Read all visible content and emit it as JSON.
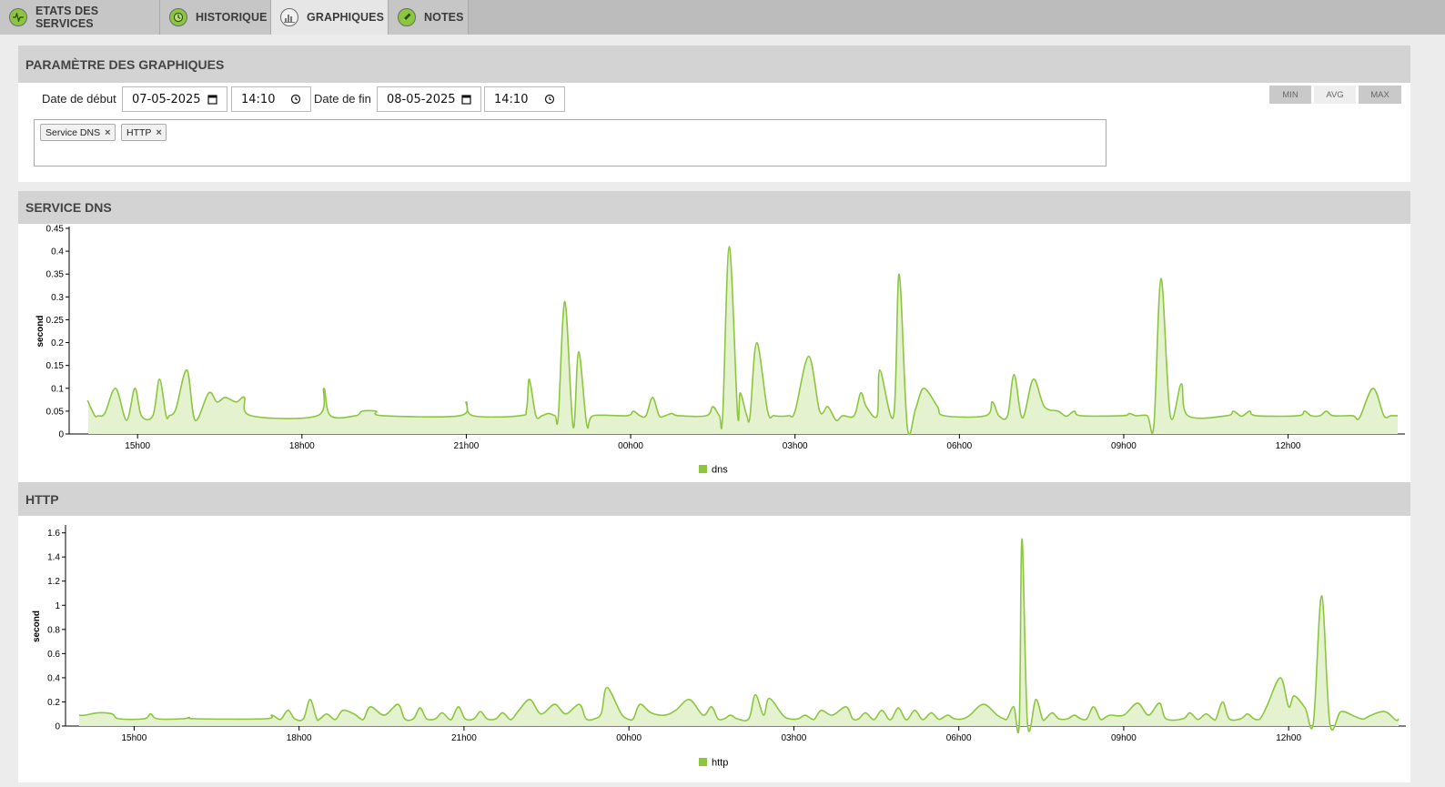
{
  "tabs": [
    {
      "label": "ETATS DES SERVICES",
      "icon": "pulse-icon",
      "active": false
    },
    {
      "label": "HISTORIQUE",
      "icon": "clock-icon",
      "active": false
    },
    {
      "label": "GRAPHIQUES",
      "icon": "bar-chart-icon",
      "active": true
    },
    {
      "label": "NOTES",
      "icon": "pencil-icon",
      "active": false
    }
  ],
  "params": {
    "title": "PARAMÈTRE DES GRAPHIQUES",
    "start_label": "Date de début",
    "start_date": "07-05-2025",
    "start_time": "14:10",
    "end_label": "Date de fin",
    "end_date": "08-05-2025",
    "end_time": "14:10",
    "tags": [
      "Service DNS",
      "HTTP"
    ],
    "tag_remove": "×",
    "aggregates": [
      "MIN",
      "AVG",
      "MAX"
    ],
    "active_aggregates": [
      "MIN",
      "MAX"
    ]
  },
  "colors": {
    "accent": "#8cc63f",
    "fill": "#e4f2cf",
    "header_bg": "#d3d3d3",
    "tabbar_bg": "#bcbcbc"
  },
  "charts": [
    {
      "title": "SERVICE DNS"
    },
    {
      "title": "HTTP"
    }
  ],
  "chart_data": [
    {
      "type": "area",
      "title": "SERVICE DNS",
      "ylabel": "second",
      "xlabel": "",
      "x_ticks": [
        "15h00",
        "18h00",
        "21h00",
        "00h00",
        "03h00",
        "06h00",
        "09h00",
        "12h00"
      ],
      "x_tick_hours": [
        15,
        18,
        21,
        24,
        27,
        30,
        33,
        36
      ],
      "x_range_hours": [
        14.1,
        38.0
      ],
      "yticks": [
        0,
        0.05,
        0.1,
        0.15,
        0.2,
        0.25,
        0.3,
        0.35,
        0.4,
        0.45
      ],
      "ytick_labels": [
        "0",
        "0.05",
        "0.1",
        "0.15",
        "0.2",
        "0.25",
        "0.3",
        "0.35",
        "0.4",
        "0.45"
      ],
      "ylim": [
        0,
        0.45
      ],
      "legend": "bottom",
      "series": [
        {
          "name": "dns",
          "color": "#8cc63f",
          "baseline": 0.04,
          "spikes": [
            [
              14.1,
              0.07
            ],
            [
              14.4,
              0.045
            ],
            [
              14.6,
              0.1
            ],
            [
              14.8,
              0.03
            ],
            [
              14.95,
              0.1
            ],
            [
              15.4,
              0.12
            ],
            [
              15.7,
              0.055
            ],
            [
              15.9,
              0.14
            ],
            [
              16.05,
              0.03
            ],
            [
              16.3,
              0.09
            ],
            [
              16.45,
              0.07
            ],
            [
              16.6,
              0.08
            ],
            [
              16.8,
              0.07
            ],
            [
              16.95,
              0.08
            ],
            [
              18.4,
              0.1
            ],
            [
              19.1,
              0.05
            ],
            [
              19.35,
              0.05
            ],
            [
              21.0,
              0.07
            ],
            [
              22.1,
              0.055
            ],
            [
              22.15,
              0.12
            ],
            [
              22.5,
              0.045
            ],
            [
              22.8,
              0.29
            ],
            [
              22.95,
              0.015
            ],
            [
              23.05,
              0.18
            ],
            [
              23.2,
              0.02
            ],
            [
              24.05,
              0.05
            ],
            [
              24.4,
              0.08
            ],
            [
              24.75,
              0.045
            ],
            [
              25.5,
              0.06
            ],
            [
              25.8,
              0.41
            ],
            [
              25.95,
              0.045
            ],
            [
              26.0,
              0.09
            ],
            [
              26.3,
              0.2
            ],
            [
              26.5,
              0.05
            ],
            [
              27.0,
              0.05
            ],
            [
              27.25,
              0.17
            ],
            [
              27.45,
              0.05
            ],
            [
              27.6,
              0.06
            ],
            [
              27.75,
              0.03
            ],
            [
              28.2,
              0.09
            ],
            [
              28.3,
              0.06
            ],
            [
              28.5,
              0.04
            ],
            [
              28.55,
              0.14
            ],
            [
              28.8,
              0.04
            ],
            [
              28.9,
              0.35
            ],
            [
              29.05,
              0.015
            ],
            [
              29.2,
              0.055
            ],
            [
              29.35,
              0.1
            ],
            [
              29.6,
              0.06
            ],
            [
              30.6,
              0.07
            ],
            [
              31.0,
              0.13
            ],
            [
              31.15,
              0.035
            ],
            [
              31.35,
              0.12
            ],
            [
              31.55,
              0.06
            ],
            [
              31.8,
              0.05
            ],
            [
              32.1,
              0.05
            ],
            [
              33.1,
              0.045
            ],
            [
              33.55,
              0.02
            ],
            [
              33.68,
              0.34
            ],
            [
              33.85,
              0.04
            ],
            [
              34.05,
              0.11
            ],
            [
              35.0,
              0.05
            ],
            [
              35.3,
              0.05
            ],
            [
              36.3,
              0.05
            ],
            [
              36.7,
              0.05
            ],
            [
              37.3,
              0.035
            ],
            [
              37.55,
              0.1
            ],
            [
              37.75,
              0.04
            ]
          ]
        }
      ]
    },
    {
      "type": "area",
      "title": "HTTP",
      "ylabel": "second",
      "xlabel": "",
      "x_ticks": [
        "15h00",
        "18h00",
        "21h00",
        "00h00",
        "03h00",
        "06h00",
        "09h00",
        "12h00"
      ],
      "x_tick_hours": [
        15,
        18,
        21,
        24,
        27,
        30,
        33,
        36
      ],
      "x_range_hours": [
        14.0,
        38.0
      ],
      "yticks": [
        0,
        0.2,
        0.4,
        0.6,
        0.8,
        1,
        1.2,
        1.4,
        1.6
      ],
      "ytick_labels": [
        "0",
        "0.2",
        "0.4",
        "0.6",
        "0.8",
        "1",
        "1.2",
        "1.4",
        "1.6"
      ],
      "ylim": [
        0,
        1.65
      ],
      "legend": "bottom",
      "series": [
        {
          "name": "http",
          "color": "#8cc63f",
          "baseline": 0.06,
          "spikes": [
            [
              14.1,
              0.09
            ],
            [
              14.35,
              0.11
            ],
            [
              14.6,
              0.1
            ],
            [
              15.3,
              0.1
            ],
            [
              16.0,
              0.07
            ],
            [
              17.5,
              0.09
            ],
            [
              17.8,
              0.13
            ],
            [
              18.2,
              0.22
            ],
            [
              18.5,
              0.1
            ],
            [
              18.8,
              0.13
            ],
            [
              19.0,
              0.1
            ],
            [
              19.3,
              0.16
            ],
            [
              19.55,
              0.09
            ],
            [
              19.8,
              0.18
            ],
            [
              20.2,
              0.15
            ],
            [
              20.6,
              0.11
            ],
            [
              20.9,
              0.16
            ],
            [
              21.3,
              0.12
            ],
            [
              21.7,
              0.11
            ],
            [
              22.0,
              0.13
            ],
            [
              22.2,
              0.22
            ],
            [
              22.4,
              0.1
            ],
            [
              22.65,
              0.18
            ],
            [
              22.85,
              0.1
            ],
            [
              23.1,
              0.18
            ],
            [
              23.5,
              0.11
            ],
            [
              23.6,
              0.32
            ],
            [
              23.85,
              0.11
            ],
            [
              24.2,
              0.18
            ],
            [
              24.4,
              0.11
            ],
            [
              24.65,
              0.09
            ],
            [
              24.85,
              0.13
            ],
            [
              25.1,
              0.22
            ],
            [
              25.35,
              0.09
            ],
            [
              25.5,
              0.16
            ],
            [
              25.85,
              0.09
            ],
            [
              26.3,
              0.26
            ],
            [
              26.45,
              0.09
            ],
            [
              26.55,
              0.23
            ],
            [
              26.8,
              0.09
            ],
            [
              27.2,
              0.09
            ],
            [
              27.5,
              0.13
            ],
            [
              27.7,
              0.09
            ],
            [
              27.95,
              0.16
            ],
            [
              28.3,
              0.11
            ],
            [
              28.6,
              0.13
            ],
            [
              28.9,
              0.15
            ],
            [
              29.2,
              0.13
            ],
            [
              29.5,
              0.11
            ],
            [
              29.8,
              0.09
            ],
            [
              30.2,
              0.09
            ],
            [
              30.45,
              0.18
            ],
            [
              30.7,
              0.09
            ],
            [
              31.0,
              0.16
            ],
            [
              31.1,
              0.02
            ],
            [
              31.15,
              1.55
            ],
            [
              31.25,
              0.02
            ],
            [
              31.4,
              0.22
            ],
            [
              31.7,
              0.11
            ],
            [
              32.1,
              0.09
            ],
            [
              32.45,
              0.16
            ],
            [
              32.75,
              0.09
            ],
            [
              33.0,
              0.09
            ],
            [
              33.25,
              0.19
            ],
            [
              33.45,
              0.09
            ],
            [
              33.65,
              0.19
            ],
            [
              34.2,
              0.11
            ],
            [
              34.5,
              0.1
            ],
            [
              34.8,
              0.2
            ],
            [
              35.25,
              0.1
            ],
            [
              35.6,
              0.16
            ],
            [
              35.85,
              0.4
            ],
            [
              36.0,
              0.16
            ],
            [
              36.1,
              0.25
            ],
            [
              36.3,
              0.15
            ],
            [
              36.45,
              0.03
            ],
            [
              36.6,
              1.08
            ],
            [
              36.75,
              0.02
            ],
            [
              36.95,
              0.12
            ],
            [
              37.2,
              0.08
            ],
            [
              37.5,
              0.09
            ],
            [
              37.75,
              0.12
            ],
            [
              37.95,
              0.05
            ]
          ]
        }
      ]
    }
  ]
}
